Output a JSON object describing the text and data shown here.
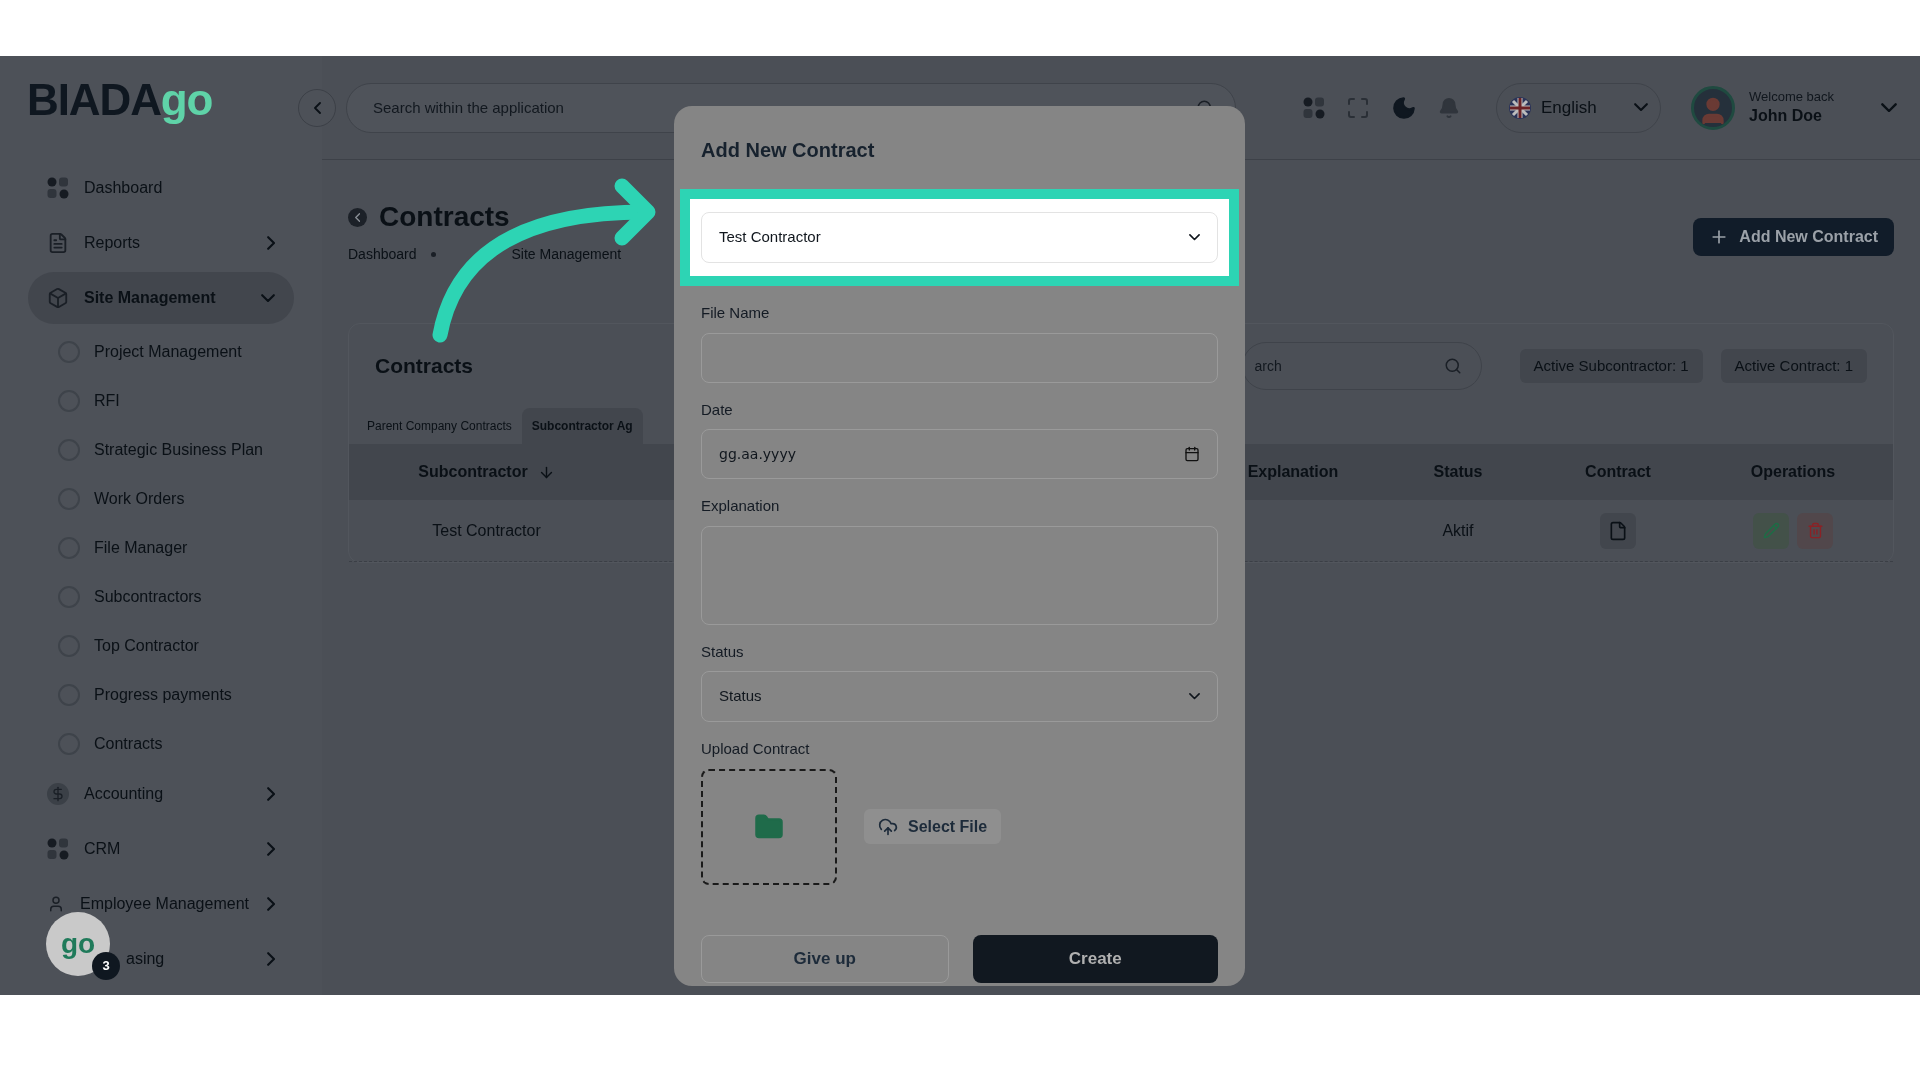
{
  "logo": {
    "text": "BIADA",
    "accent": "go"
  },
  "sidebar": {
    "items": [
      {
        "label": "Dashboard",
        "selected": false
      },
      {
        "label": "Reports",
        "expanded": false,
        "selected": false
      },
      {
        "label": "Site Management",
        "expanded": true,
        "selected": true,
        "children": [
          {
            "label": "Project Management"
          },
          {
            "label": "RFI"
          },
          {
            "label": "Strategic Business Plan"
          },
          {
            "label": "Work Orders"
          },
          {
            "label": "File Manager"
          },
          {
            "label": "Subcontractors"
          },
          {
            "label": "Top Contractor"
          },
          {
            "label": "Progress payments"
          },
          {
            "label": "Contracts"
          }
        ]
      },
      {
        "label": "Accounting",
        "expanded": false,
        "selected": false
      },
      {
        "label": "CRM",
        "expanded": false,
        "selected": false
      },
      {
        "label": "Employee Management",
        "expanded": false,
        "selected": false
      },
      {
        "label": "asing",
        "expanded": false,
        "selected": false
      }
    ]
  },
  "header": {
    "search": {
      "placeholder": "Search within the application"
    },
    "language": "English",
    "user": {
      "greeting": "Welcome back",
      "name": "John Doe"
    }
  },
  "page": {
    "title": "Contracts",
    "breadcrumb": [
      "Dashboard",
      "Site Management"
    ],
    "add_button": "Add New Contract"
  },
  "card": {
    "title": "Contracts",
    "search": {
      "placeholder": "arch"
    },
    "badges": [
      "Active Subcontractor: 1",
      "Active Contract: 1"
    ],
    "tabs": [
      {
        "label": "Parent Company Contracts",
        "selected": false
      },
      {
        "label": "Subcontractor Ag",
        "selected": true
      }
    ],
    "table": {
      "columns": [
        {
          "label": "Subcontractor",
          "sorted": true
        },
        {
          "label": "Explanation",
          "sorted": false
        },
        {
          "label": "Status",
          "sorted": false
        },
        {
          "label": "Contract",
          "sorted": false
        },
        {
          "label": "Operations",
          "sorted": false
        }
      ],
      "rows": [
        {
          "subcontractor": "Test Contractor",
          "status": "Aktif"
        }
      ]
    }
  },
  "modal": {
    "title": "Add New Contract",
    "fields": [
      {
        "kind": "select",
        "value": "Test Contractor",
        "highlighted": true
      },
      {
        "kind": "text",
        "label": "File Name",
        "highlighted": false
      },
      {
        "kind": "date",
        "label": "Date",
        "value": "gg.aa.yyyy",
        "highlighted": false
      },
      {
        "kind": "textarea",
        "label": "Explanation",
        "highlighted": false
      },
      {
        "kind": "select",
        "label": "Status",
        "value": "Status",
        "highlighted": false
      },
      {
        "kind": "upload",
        "label": "Upload Contract",
        "button": "Select File",
        "highlighted": false
      }
    ],
    "buttons": [
      {
        "label": "Give up",
        "kind": "secondary"
      },
      {
        "label": "Create",
        "kind": "primary"
      }
    ]
  },
  "helper": {
    "count": "3",
    "logo": "go"
  }
}
